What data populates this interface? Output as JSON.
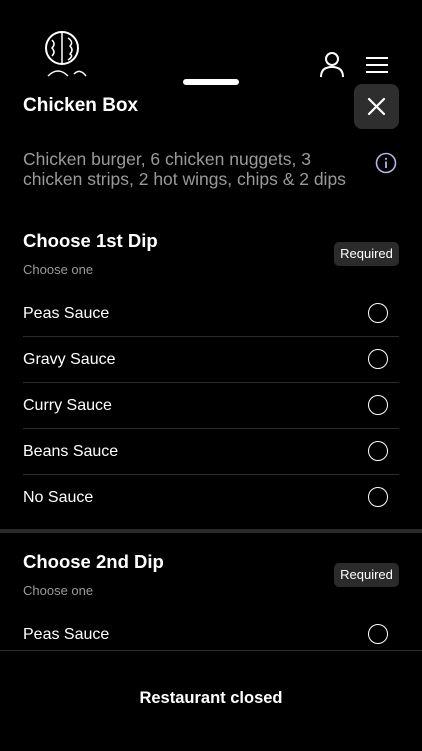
{
  "header": {
    "logo_icon": "restaurant-logo-icon",
    "account_icon": "user-icon",
    "menu_icon": "hamburger-menu-icon"
  },
  "modal": {
    "title": "Chicken Box",
    "description": "Chicken burger, 6 chicken nuggets, 3 chicken strips, 2 hot wings, chips & 2 dips",
    "close_icon": "close-icon",
    "info_icon": "info-icon"
  },
  "groups": [
    {
      "title": "Choose 1st Dip",
      "subtitle": "Choose one",
      "badge": "Required",
      "options": [
        "Peas Sauce",
        "Gravy Sauce",
        "Curry Sauce",
        "Beans Sauce",
        "No Sauce"
      ]
    },
    {
      "title": "Choose 2nd Dip",
      "subtitle": "Choose one",
      "badge": "Required",
      "options": [
        "Peas Sauce"
      ]
    }
  ],
  "footer": {
    "status_text": "Restaurant closed"
  },
  "colors": {
    "background": "#000000",
    "text": "#ffffff",
    "muted_text": "#9a9a9a",
    "badge_bg": "#2b2b2b",
    "info_accent": "#b4b4e6"
  }
}
